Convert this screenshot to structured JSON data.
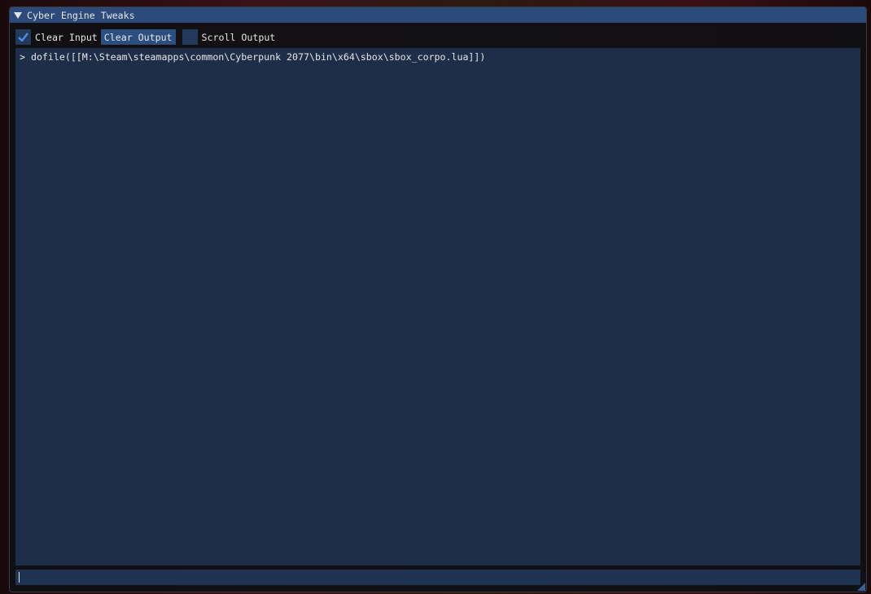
{
  "window": {
    "title": "Cyber Engine Tweaks"
  },
  "toolbar": {
    "clear_input": {
      "label": "Clear Input",
      "checked": true
    },
    "clear_output_label": "Clear Output",
    "scroll_output": {
      "label": "Scroll Output",
      "checked": false
    }
  },
  "output": {
    "lines": [
      "> dofile([[M:\\Steam\\steamapps\\common\\Cyberpunk 2077\\bin\\x64\\sbox\\sbox_corpo.lua]])"
    ]
  },
  "input": {
    "value": ""
  }
}
